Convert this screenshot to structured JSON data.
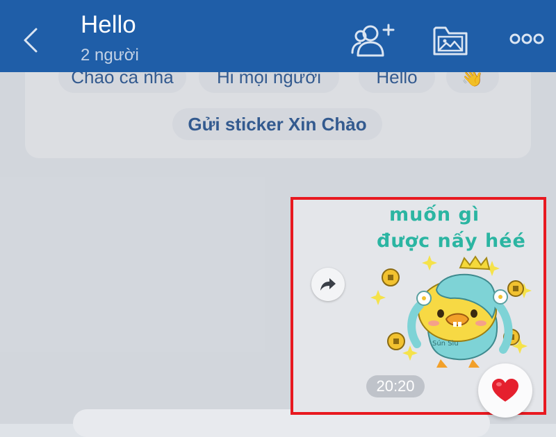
{
  "header": {
    "title": "Hello",
    "subtitle": "2 người",
    "icons": [
      "back-icon",
      "add-member-icon",
      "media-folder-icon",
      "more-options-icon"
    ]
  },
  "quick_replies": {
    "row1": [
      "Chao ca nha",
      "Hi mọi người",
      "Hello"
    ],
    "wave_emoji": "👋",
    "sticker_button": "Gửi sticker Xin Chào"
  },
  "message": {
    "sticker_line1": "muốn gì",
    "sticker_line2": "được nấy héé",
    "sticker_tag": "Sún Sìu",
    "time": "20:20",
    "reaction_icon": "heart-icon"
  },
  "colors": {
    "header_bg": "#1f5ea8",
    "chip_text": "#365f96",
    "highlight": "#e81920",
    "heart": "#e5202e",
    "sticker_text": "#2bb5a2"
  }
}
